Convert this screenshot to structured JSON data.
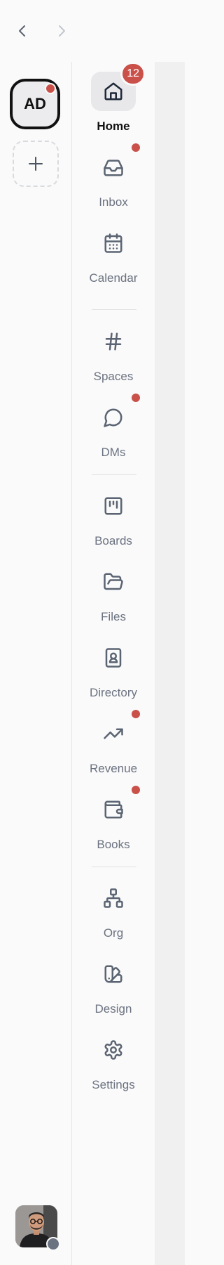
{
  "topbar": {
    "back_icon": "chevron-left-icon",
    "forward_icon": "chevron-right-icon"
  },
  "rail": {
    "workspace": {
      "initials": "AD",
      "has_notification": true
    },
    "add_workspace_icon": "plus-icon",
    "user_status": "offline"
  },
  "nav": {
    "items": [
      {
        "label": "Home",
        "icon": "home-icon",
        "active": true,
        "badge": "12"
      },
      {
        "label": "Inbox",
        "icon": "inbox-icon",
        "dot": true
      },
      {
        "label": "Calendar",
        "icon": "calendar-icon"
      },
      {
        "label": "Spaces",
        "icon": "hash-icon"
      },
      {
        "label": "DMs",
        "icon": "message-circle-icon",
        "dot": true
      },
      {
        "label": "Boards",
        "icon": "kanban-icon"
      },
      {
        "label": "Files",
        "icon": "folder-open-icon"
      },
      {
        "label": "Directory",
        "icon": "contact-book-icon"
      },
      {
        "label": "Revenue",
        "icon": "trending-up-icon",
        "dot": true
      },
      {
        "label": "Books",
        "icon": "wallet-icon",
        "dot": true
      },
      {
        "label": "Org",
        "icon": "org-chart-icon"
      },
      {
        "label": "Design",
        "icon": "palette-icon"
      },
      {
        "label": "Settings",
        "icon": "gear-icon"
      }
    ]
  },
  "colors": {
    "accent": "#c9514a",
    "icon": "#5b6472",
    "active_bg": "#e8e8eb"
  }
}
